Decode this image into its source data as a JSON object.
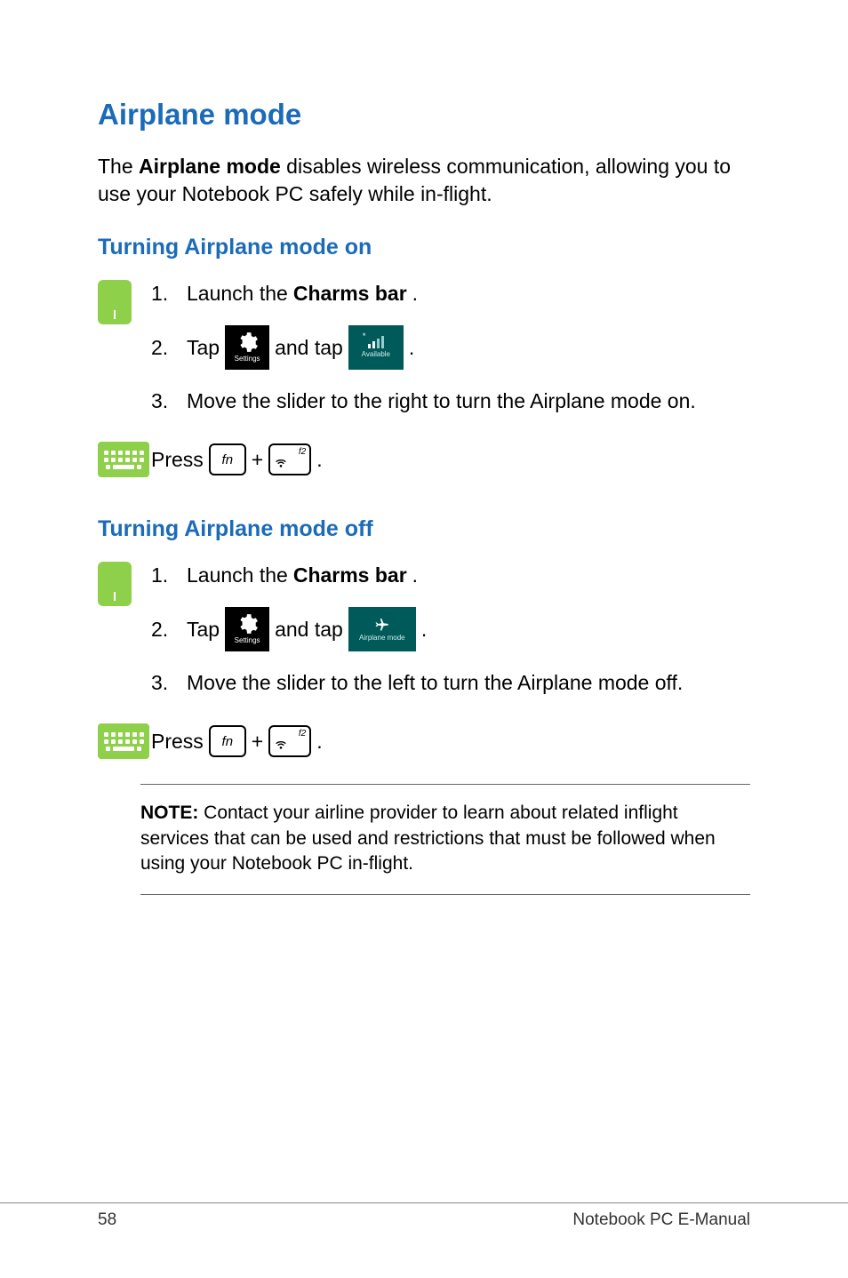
{
  "title": "Airplane mode",
  "intro_pre": "The ",
  "intro_bold": "Airplane mode",
  "intro_post": " disables wireless communication, allowing you to use your Notebook PC safely while in-flight.",
  "sections": {
    "on": {
      "heading": "Turning Airplane mode on",
      "step1_pre": "Launch the ",
      "step1_bold": "Charms bar",
      "step1_post": ".",
      "step2_a": "Tap ",
      "step2_b": " and tap ",
      "step2_c": " .",
      "step3": "Move the slider to the right to turn the Airplane mode on.",
      "press": "Press ",
      "plus": " + ",
      "dot": "."
    },
    "off": {
      "heading": "Turning Airplane mode off",
      "step1_pre": "Launch the ",
      "step1_bold": "Charms bar",
      "step1_post": ".",
      "step2_a": "Tap ",
      "step2_b": " and tap ",
      "step2_c": " .",
      "step3": " Move the slider to the left to turn the Airplane mode off.",
      "press": "Press ",
      "plus": " + ",
      "dot": "."
    }
  },
  "nums": {
    "n1": "1.",
    "n2": "2.",
    "n3": "3."
  },
  "tiles": {
    "settings": "Settings",
    "available": "Available",
    "airplane": "Airplane mode"
  },
  "keys": {
    "fn": "fn",
    "f2": "f2"
  },
  "note_bold": "NOTE:",
  "note_body": " Contact your airline provider to learn about related inflight services that can be used and restrictions that must be followed when using your Notebook PC in-flight.",
  "footer": {
    "page": "58",
    "label": "Notebook PC E-Manual"
  }
}
